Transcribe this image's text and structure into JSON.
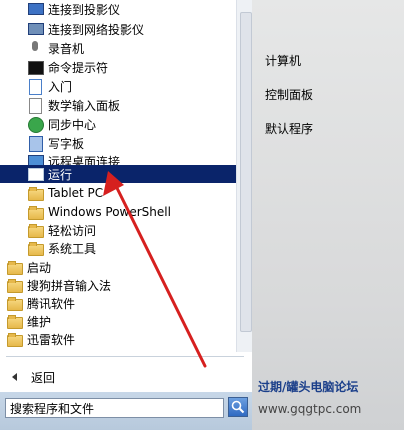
{
  "menu": {
    "items": [
      {
        "label": "连接到投影仪",
        "icon": "projector-icon"
      },
      {
        "label": "连接到网络投影仪",
        "icon": "network-projector-icon"
      },
      {
        "label": "录音机",
        "icon": "microphone-icon"
      },
      {
        "label": "命令提示符",
        "icon": "command-prompt-icon"
      },
      {
        "label": "入门",
        "icon": "getting-started-icon"
      },
      {
        "label": "数学输入面板",
        "icon": "math-input-icon"
      },
      {
        "label": "同步中心",
        "icon": "sync-center-icon"
      },
      {
        "label": "写字板",
        "icon": "wordpad-icon"
      },
      {
        "label": "远程桌面连接",
        "icon": "remote-desktop-icon"
      },
      {
        "label": "运行",
        "icon": "run-icon"
      },
      {
        "label": "Tablet PC",
        "icon": "folder-icon"
      },
      {
        "label": "Windows PowerShell",
        "icon": "folder-icon"
      },
      {
        "label": "轻松访问",
        "icon": "folder-icon"
      },
      {
        "label": "系统工具",
        "icon": "folder-icon"
      },
      {
        "label": "启动",
        "icon": "folder-icon"
      },
      {
        "label": "搜狗拼音输入法",
        "icon": "folder-icon"
      },
      {
        "label": "腾讯软件",
        "icon": "folder-icon"
      },
      {
        "label": "维护",
        "icon": "folder-icon"
      },
      {
        "label": "迅雷软件",
        "icon": "folder-icon"
      }
    ],
    "selected_label": "运行"
  },
  "back_label": "返回",
  "search": {
    "value": "搜索程序和文件"
  },
  "right_panel": {
    "items": [
      "计算机",
      "控制面板",
      "默认程序"
    ]
  },
  "watermark": {
    "text": "过期/罐头电脑论坛",
    "url": "www.gqgtpc.com"
  },
  "colors": {
    "selection": "#0a246a",
    "annotation_arrow": "#d6201f"
  }
}
